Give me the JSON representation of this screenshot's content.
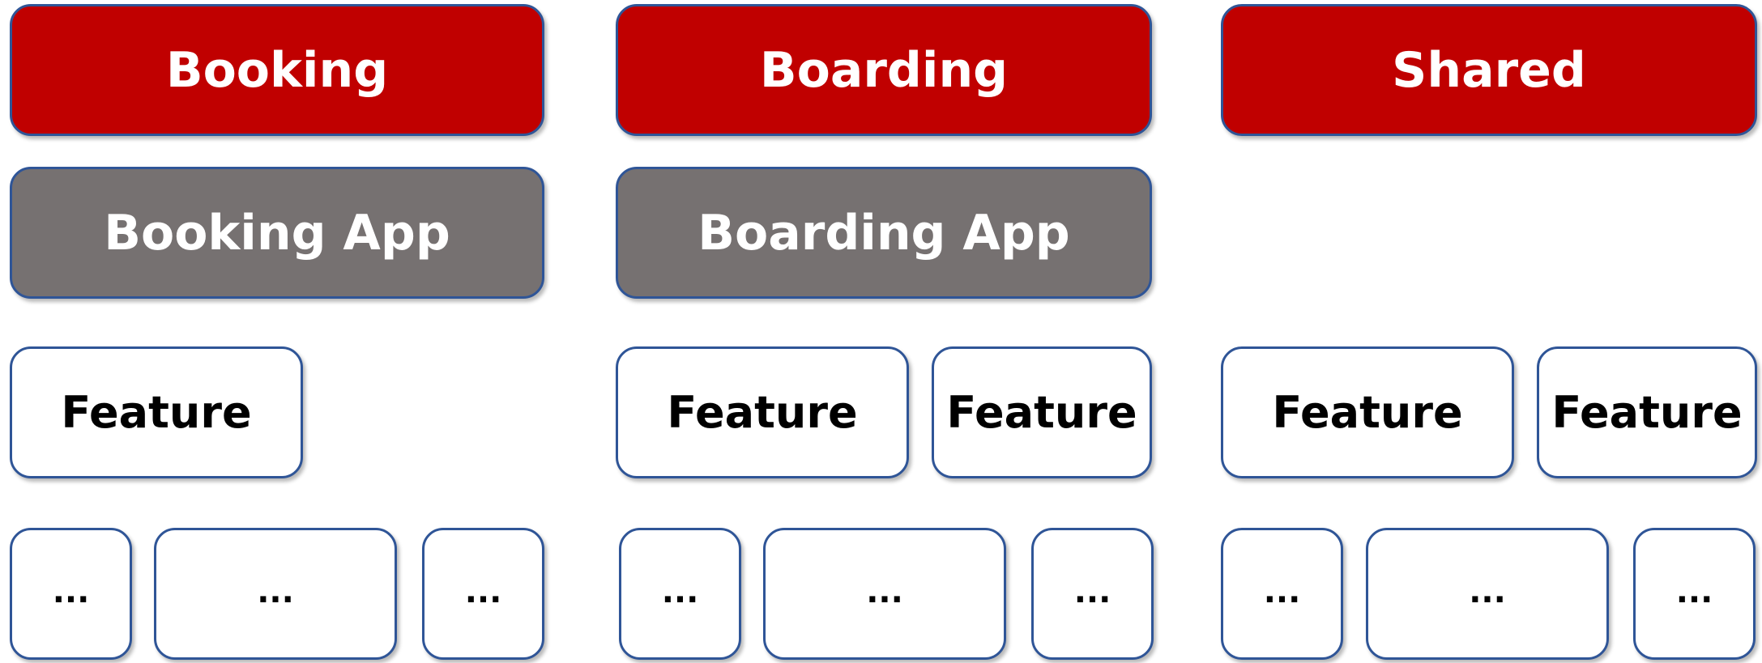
{
  "columns": [
    {
      "domain": "Booking",
      "app": "Booking App",
      "features": [
        "Feature"
      ],
      "sub_items": [
        "...",
        "...",
        "..."
      ]
    },
    {
      "domain": "Boarding",
      "app": "Boarding App",
      "features": [
        "Feature",
        "Feature"
      ],
      "sub_items": [
        "...",
        "...",
        "..."
      ]
    },
    {
      "domain": "Shared",
      "features": [
        "Feature",
        "Feature"
      ],
      "sub_items": [
        "...",
        "...",
        "..."
      ]
    }
  ],
  "colors": {
    "domain_fill": "#c00000",
    "app_fill": "#767171",
    "border": "#2f5597",
    "feature_fill": "#ffffff"
  }
}
